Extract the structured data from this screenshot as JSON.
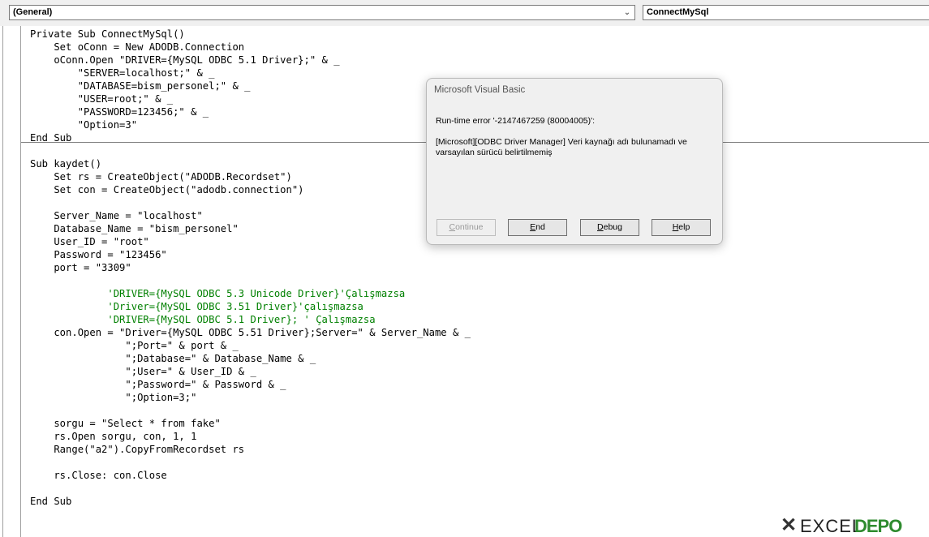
{
  "toolbar": {
    "object_combo": "(General)",
    "procedure_combo": "ConnectMySql",
    "arrow": "⌄"
  },
  "code_lines": [
    {
      "text": "Private Sub ConnectMySql()",
      "type": "code"
    },
    {
      "text": "    Set oConn = New ADODB.Connection",
      "type": "code"
    },
    {
      "text": "    oConn.Open \"DRIVER={MySQL ODBC 5.1 Driver};\" & _",
      "type": "code"
    },
    {
      "text": "        \"SERVER=localhost;\" & _",
      "type": "code"
    },
    {
      "text": "        \"DATABASE=bism_personel;\" & _",
      "type": "code"
    },
    {
      "text": "        \"USER=root;\" & _",
      "type": "code"
    },
    {
      "text": "        \"PASSWORD=123456;\" & _",
      "type": "code"
    },
    {
      "text": "        \"Option=3\"",
      "type": "code"
    },
    {
      "text": "End Sub",
      "type": "code"
    },
    {
      "text": "",
      "type": "code"
    },
    {
      "text": "Sub kaydet()",
      "type": "code"
    },
    {
      "text": "    Set rs = CreateObject(\"ADODB.Recordset\")",
      "type": "code"
    },
    {
      "text": "    Set con = CreateObject(\"adodb.connection\")",
      "type": "code"
    },
    {
      "text": "",
      "type": "code"
    },
    {
      "text": "    Server_Name = \"localhost\"",
      "type": "code"
    },
    {
      "text": "    Database_Name = \"bism_personel\"",
      "type": "code"
    },
    {
      "text": "    User_ID = \"root\"",
      "type": "code"
    },
    {
      "text": "    Password = \"123456\"",
      "type": "code"
    },
    {
      "text": "    port = \"3309\"",
      "type": "code"
    },
    {
      "text": "",
      "type": "code"
    },
    {
      "text": "             'DRIVER={MySQL ODBC 5.3 Unicode Driver}'Çalışmazsa",
      "type": "comment"
    },
    {
      "text": "             'Driver={MySQL ODBC 3.51 Driver}'çalışmazsa",
      "type": "comment"
    },
    {
      "text": "             'DRIVER={MySQL ODBC 5.1 Driver}; ' Çalışmazsa",
      "type": "comment"
    },
    {
      "text": "    con.Open = \"Driver={MySQL ODBC 5.51 Driver};Server=\" & Server_Name & _",
      "type": "code"
    },
    {
      "text": "                \";Port=\" & port & _",
      "type": "code"
    },
    {
      "text": "                \";Database=\" & Database_Name & _",
      "type": "code"
    },
    {
      "text": "                \";User=\" & User_ID & _",
      "type": "code"
    },
    {
      "text": "                \";Password=\" & Password & _",
      "type": "code"
    },
    {
      "text": "                \";Option=3;\"",
      "type": "code"
    },
    {
      "text": "",
      "type": "code"
    },
    {
      "text": "    sorgu = \"Select * from fake\"",
      "type": "code"
    },
    {
      "text": "    rs.Open sorgu, con, 1, 1",
      "type": "code"
    },
    {
      "text": "    Range(\"a2\").CopyFromRecordset rs",
      "type": "code"
    },
    {
      "text": "",
      "type": "code"
    },
    {
      "text": "    rs.Close: con.Close",
      "type": "code"
    },
    {
      "text": "",
      "type": "code"
    },
    {
      "text": "End Sub",
      "type": "code"
    }
  ],
  "dialog": {
    "title": "Microsoft Visual Basic",
    "error_line": "Run-time error '-2147467259 (80004005)':",
    "message": "[Microsoft][ODBC Driver Manager] Veri kaynağı adı bulunamadı ve varsayılan sürücü belirtilmemiş",
    "buttons": {
      "continue": {
        "access": "C",
        "rest": "ontinue",
        "enabled": false
      },
      "end": {
        "access": "E",
        "rest": "nd",
        "enabled": true
      },
      "debug": {
        "access": "D",
        "rest": "ebug",
        "enabled": true
      },
      "help": {
        "access": "H",
        "rest": "elp",
        "enabled": true
      }
    }
  },
  "logo": {
    "part1": "EXCEL",
    "part2": "DEPO"
  }
}
